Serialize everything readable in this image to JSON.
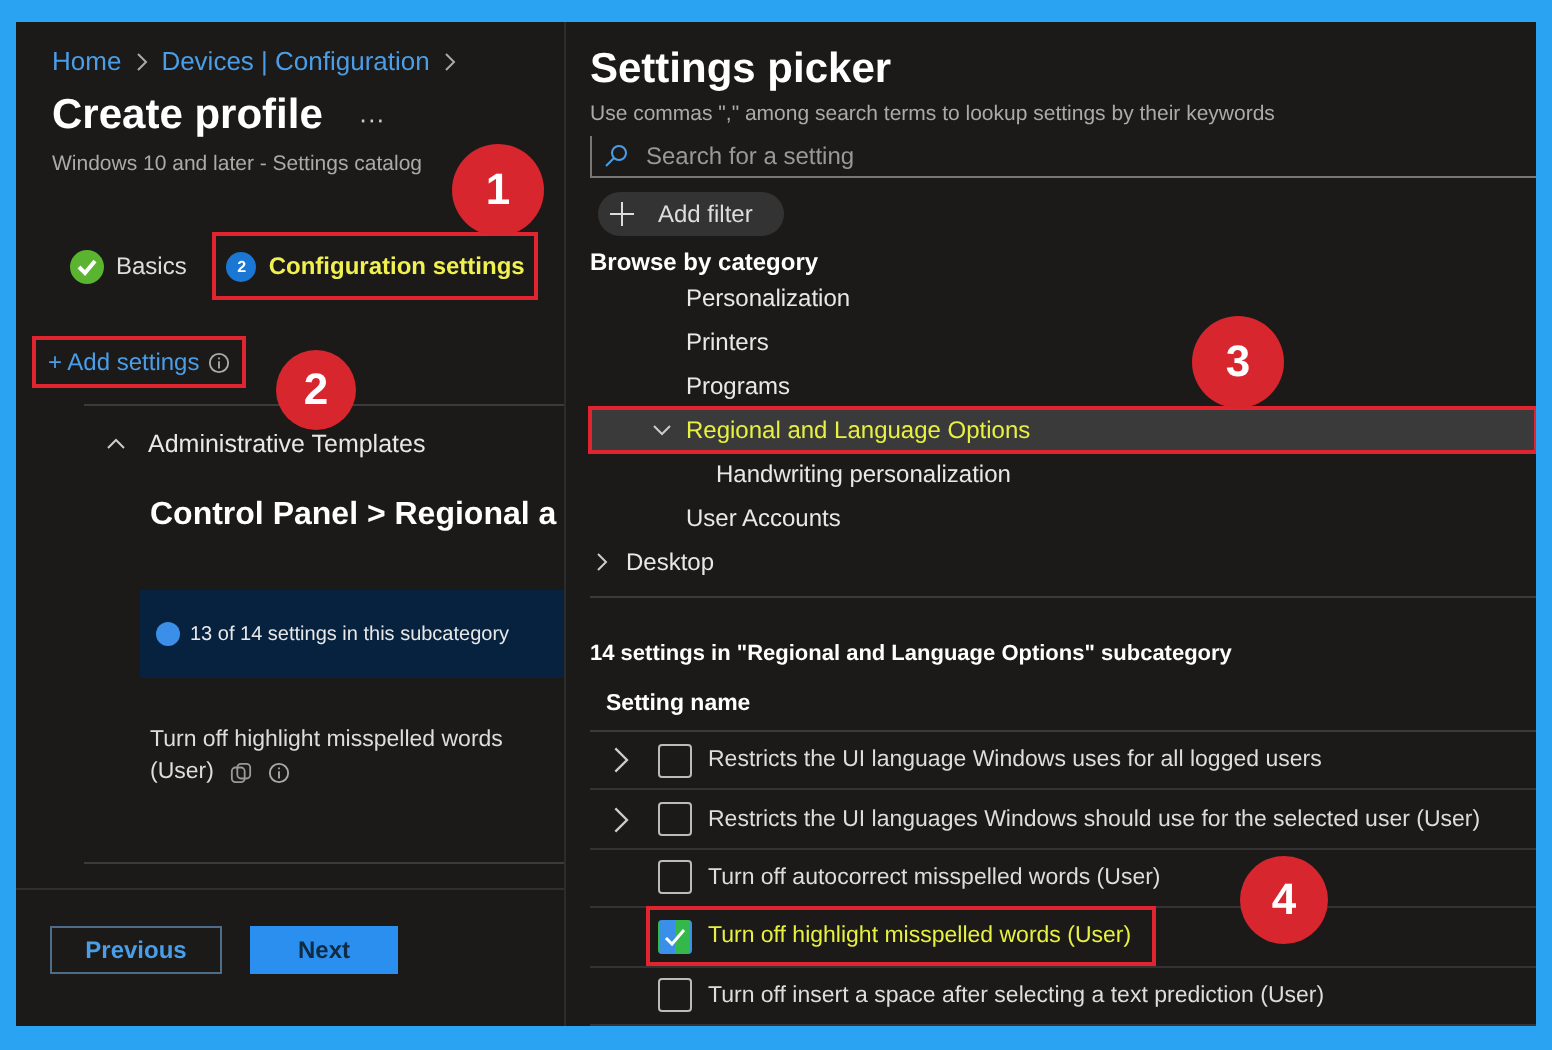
{
  "breadcrumb": [
    "Home",
    "Devices | Configuration"
  ],
  "profile": {
    "title": "Create profile",
    "more": "···",
    "subtitle": "Windows 10 and later - Settings catalog"
  },
  "wizard_tabs": [
    {
      "label": "Basics",
      "kind": "done",
      "selected": false,
      "boxed": false
    },
    {
      "label": "Configuration settings",
      "step": "2",
      "kind": "current",
      "selected": true,
      "boxed": true
    }
  ],
  "add_settings": {
    "label": "+ Add settings",
    "boxed": true
  },
  "section": {
    "title": "Administrative Templates",
    "expanded": true,
    "heading": "Control Panel > Regional a",
    "info": "13 of 14 settings in this subcategory",
    "setting_line1": "Turn off highlight misspelled words",
    "setting_line2": "(User)"
  },
  "footer_buttons": [
    {
      "label": "Previous",
      "kind": "secondary"
    },
    {
      "label": "Next",
      "kind": "primary"
    }
  ],
  "picker": {
    "title": "Settings picker",
    "hint": "Use commas \",\" among search terms to lookup settings by their keywords",
    "search_placeholder": "Search for a setting",
    "add_filter": "Add filter",
    "browse_label": "Browse by category"
  },
  "category_tree": [
    {
      "label": "Personalization",
      "kind": "leaf",
      "selected": false,
      "boxed": false
    },
    {
      "label": "Printers",
      "kind": "leaf",
      "selected": false,
      "boxed": false
    },
    {
      "label": "Programs",
      "kind": "leaf",
      "selected": false,
      "boxed": false
    },
    {
      "label": "Regional and Language Options",
      "kind": "parent",
      "expanded": true,
      "selected": true,
      "boxed": true,
      "children": [
        {
          "label": "Handwriting personalization",
          "kind": "leaf",
          "selected": false,
          "boxed": false
        }
      ]
    },
    {
      "label": "User Accounts",
      "kind": "leaf",
      "selected": false,
      "boxed": false
    },
    {
      "label": "Desktop",
      "kind": "parent",
      "expanded": false,
      "selected": false,
      "boxed": false
    }
  ],
  "settings_table": {
    "caption": "14 settings in \"Regional and Language Options\" subcategory",
    "column": "Setting name",
    "rows": [
      {
        "label": "Restricts the UI language Windows uses for all logged users",
        "expandable": true,
        "checked": false,
        "boxed": false
      },
      {
        "label": "Restricts the UI languages Windows should use for the selected user (User)",
        "expandable": true,
        "checked": false,
        "boxed": false
      },
      {
        "label": "Turn off autocorrect misspelled words (User)",
        "expandable": false,
        "checked": false,
        "boxed": false
      },
      {
        "label": "Turn off highlight misspelled words (User)",
        "expandable": false,
        "checked": true,
        "boxed": true
      },
      {
        "label": "Turn off insert a space after selecting a text prediction (User)",
        "expandable": false,
        "checked": false,
        "boxed": false
      }
    ]
  },
  "callouts": [
    {
      "label": "1"
    },
    {
      "label": "2"
    },
    {
      "label": "3"
    },
    {
      "label": "4"
    }
  ]
}
